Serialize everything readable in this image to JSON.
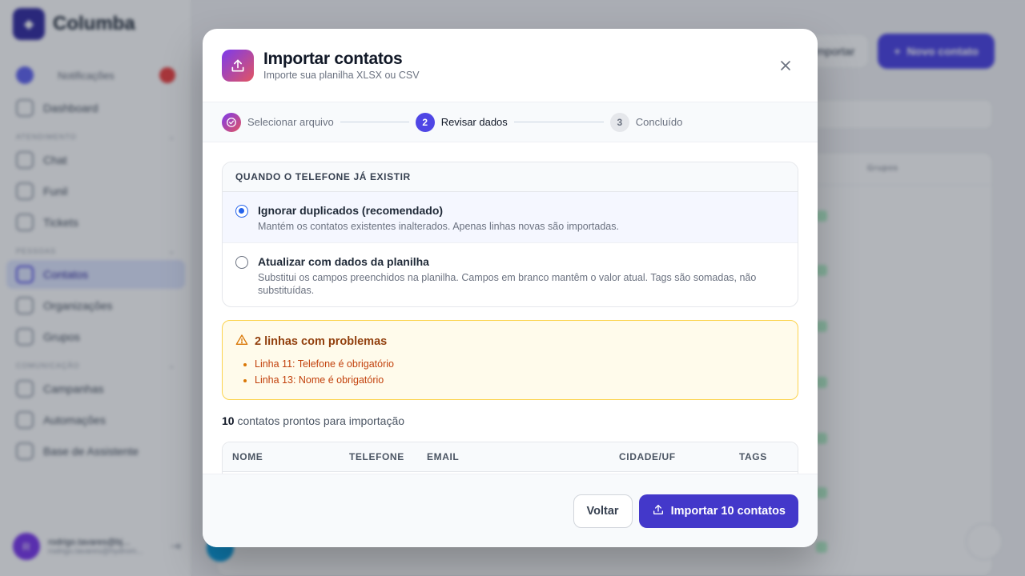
{
  "colors": {
    "accent": "#4f46e5",
    "warning_bg": "#fffbeb",
    "warning_text": "#92400e",
    "gradient_start": "#7c3aed",
    "gradient_end": "#e25561"
  },
  "background": {
    "brand": "Columba",
    "notifications_label": "Notificações",
    "nav": [
      {
        "label": "Dashboard",
        "icon": "grid-icon"
      },
      {
        "label": "Chat",
        "icon": "chat-icon"
      },
      {
        "label": "Funil",
        "icon": "funnel-icon"
      },
      {
        "label": "Tickets",
        "icon": "ticket-icon"
      },
      {
        "label": "Contatos",
        "icon": "users-icon",
        "active": true
      },
      {
        "label": "Organizações",
        "icon": "building-icon"
      },
      {
        "label": "Grupos",
        "icon": "group-icon"
      },
      {
        "label": "Campanhas",
        "icon": "send-icon"
      },
      {
        "label": "Automações",
        "icon": "phone-icon"
      },
      {
        "label": "Base de Assistente",
        "icon": "book-icon"
      }
    ],
    "sections": [
      "Atendimento",
      "Pessoas",
      "Comunicação"
    ],
    "user_name": "rodrigo.tavares@bj...",
    "user_email": "rodrigo.tavares@hydrom...",
    "user_initial": "R",
    "top_import": "Importar",
    "top_new": "Novo contato",
    "table_cols": [
      "Grupos"
    ]
  },
  "modal": {
    "title": "Importar contatos",
    "subtitle": "Importe sua planilha XLSX ou CSV",
    "steps": [
      {
        "number": "1",
        "label": "Selecionar arquivo",
        "state": "done"
      },
      {
        "number": "2",
        "label": "Revisar dados",
        "state": "current"
      },
      {
        "number": "3",
        "label": "Concluído",
        "state": "todo"
      }
    ],
    "duplicate_heading": "QUANDO O TELEFONE JÁ EXISTIR",
    "options": [
      {
        "title": "Ignorar duplicados (recomendado)",
        "description": "Mantém os contatos existentes inalterados. Apenas linhas novas são importadas.",
        "selected": true
      },
      {
        "title": "Atualizar com dados da planilha",
        "description": "Substitui os campos preenchidos na planilha. Campos em branco mantêm o valor atual. Tags são somadas, não substituídas.",
        "selected": false
      }
    ],
    "warning": {
      "title": "2 linhas com problemas",
      "items": [
        "Linha 11: Telefone é obrigatório",
        "Linha 13: Nome é obrigatório"
      ]
    },
    "ready_count": "10",
    "ready_text": " contatos prontos para importação",
    "preview_columns": [
      "NOME",
      "TELEFONE",
      "EMAIL",
      "CIDADE/UF",
      "TAGS"
    ],
    "back_label": "Voltar",
    "import_label": "Importar 10 contatos"
  }
}
